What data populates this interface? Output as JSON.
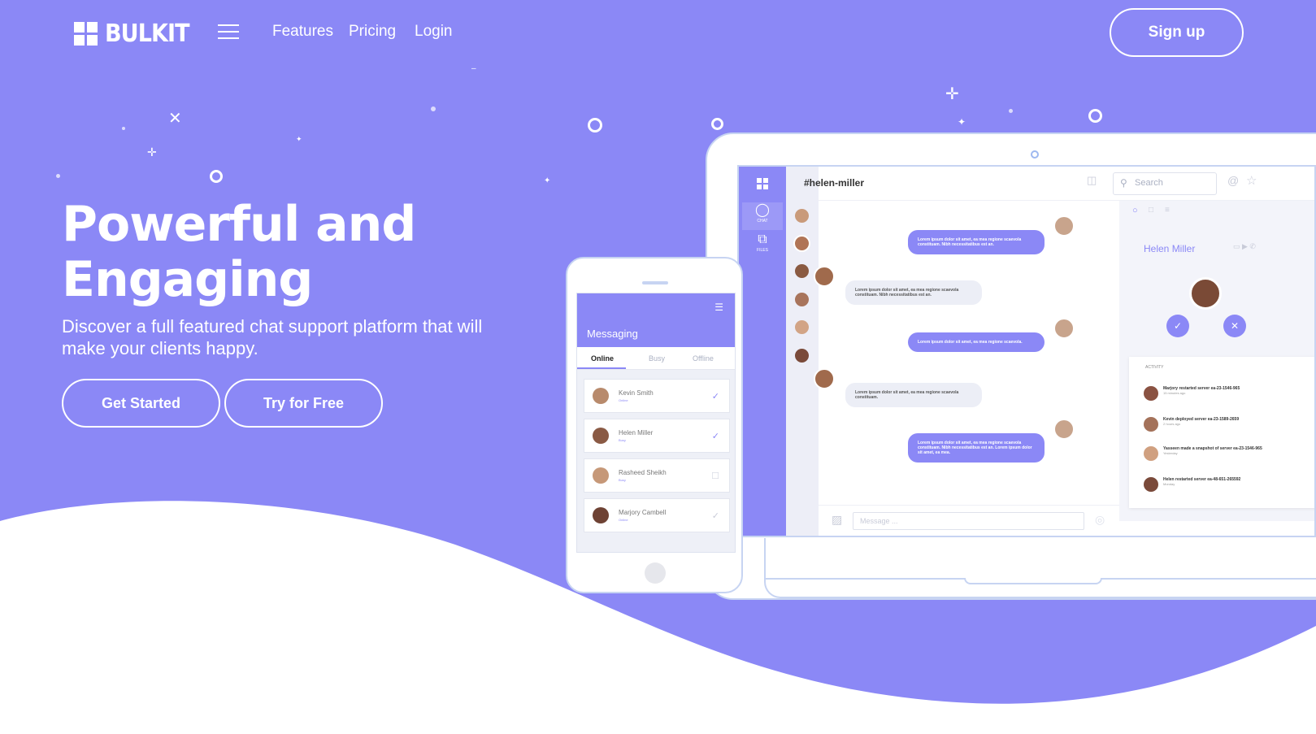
{
  "nav": {
    "logo_text": "BULKIT",
    "links": [
      "Features",
      "Pricing",
      "Login"
    ],
    "signup_label": "Sign up"
  },
  "hero": {
    "headline_line1": "Powerful and",
    "headline_line2": "Engaging",
    "subtitle": "Discover a full featured chat support platform that will make your clients happy.",
    "primary_button": "Get Started",
    "secondary_button": "Try for Free"
  },
  "colors": {
    "brand_purple": "#8b88f6",
    "device_outline": "#c7d4f2"
  },
  "desktop_app": {
    "channel": "#helen-miller",
    "search_placeholder": "Search",
    "side_tabs": [
      "CHAT",
      "FILES"
    ],
    "messages": [
      {
        "dir": "out",
        "text": "Lorem ipsum dolor sit amet, ea mea regione scaevola constituam. Nibh necessitatibus est an."
      },
      {
        "dir": "in",
        "text": "Lorem ipsum dolor sit amet, ea mea regione scaevola constituam. Nibh necessitatibus est an."
      },
      {
        "dir": "out",
        "text": "Lorem ipsum dolor sit amet, ea mea regione scaevola."
      },
      {
        "dir": "in",
        "text": "Lorem ipsum dolor sit amet, ea mea regione scaevola constituam."
      },
      {
        "dir": "out",
        "text": "Lorem ipsum dolor sit amet, ea mea regione scaevola constituam. Nibh necessitatibus est an. Lorem ipsum dolor sit amet, ea mea."
      }
    ],
    "message_placeholder": "Message ...",
    "profile_name": "Helen Miller",
    "activity_label": "ACTIVITY",
    "activity": [
      {
        "text": "Marjory restarted server ea-23-1546-965",
        "time": "15 minutes ago"
      },
      {
        "text": "Kevin deployed server ea-23-1589-2659",
        "time": "2 hours ago"
      },
      {
        "text": "Yasseen made a snapshot of server ea-23-1546-965",
        "time": "Yesterday"
      },
      {
        "text": "Helen restarted server ea-48-651-265592",
        "time": "Monday"
      }
    ]
  },
  "phone_app": {
    "title": "Messaging",
    "tabs": [
      "Online",
      "Busy",
      "Offline"
    ],
    "contacts": [
      {
        "name": "Kevin Smith",
        "status": "Online",
        "check": "✓"
      },
      {
        "name": "Helen Miller",
        "status": "Busy",
        "check": "✓"
      },
      {
        "name": "Rasheed Sheikh",
        "status": "Busy",
        "check": "☐"
      },
      {
        "name": "Marjory Cambell",
        "status": "Online",
        "check": "✓"
      }
    ]
  }
}
